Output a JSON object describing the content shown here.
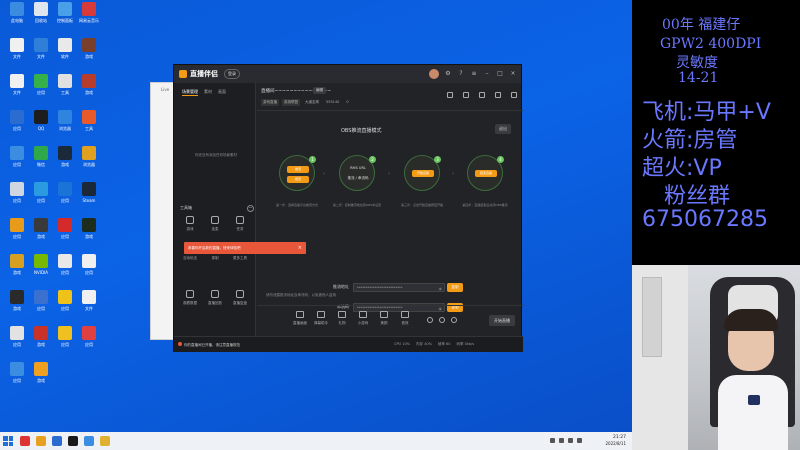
{
  "desktop": {
    "icons": [
      {
        "label": "此电脑",
        "color": "#3b8be0"
      },
      {
        "label": "回收站",
        "color": "#dfe6ee"
      },
      {
        "label": "控制面板",
        "color": "#4aa0e8"
      },
      {
        "label": "网易云音乐",
        "color": "#d63a3a"
      },
      {
        "label": "文件",
        "color": "#f0f0f0"
      },
      {
        "label": "文件",
        "color": "#2f7fd8"
      },
      {
        "label": "软件",
        "color": "#e9e9e9"
      },
      {
        "label": "游戏",
        "color": "#7a3f2a"
      },
      {
        "label": "文件",
        "color": "#f0f0f0"
      },
      {
        "label": "应用",
        "color": "#36b14a"
      },
      {
        "label": "工具",
        "color": "#e0e0e0"
      },
      {
        "label": "游戏",
        "color": "#b83c2c"
      },
      {
        "label": "应用",
        "color": "#2b6cd0"
      },
      {
        "label": "QQ",
        "color": "#1d1d1d"
      },
      {
        "label": "浏览器",
        "color": "#2f84e0"
      },
      {
        "label": "工具",
        "color": "#e85a2a"
      },
      {
        "label": "应用",
        "color": "#3a8de0"
      },
      {
        "label": "微信",
        "color": "#2fa84a"
      },
      {
        "label": "游戏",
        "color": "#1b2a3a"
      },
      {
        "label": "浏览器",
        "color": "#e0a020"
      },
      {
        "label": "应用",
        "color": "#cfd6df"
      },
      {
        "label": "应用",
        "color": "#2a9be0"
      },
      {
        "label": "应用",
        "color": "#1a73d6"
      },
      {
        "label": "Steam",
        "color": "#1b2838"
      },
      {
        "label": "应用",
        "color": "#e89a1a"
      },
      {
        "label": "游戏",
        "color": "#3a3a3a"
      },
      {
        "label": "应用",
        "color": "#d42a2a"
      },
      {
        "label": "游戏",
        "color": "#1d2d1d"
      },
      {
        "label": "游戏",
        "color": "#d8a020"
      },
      {
        "label": "NVIDIA",
        "color": "#76b900"
      },
      {
        "label": "应用",
        "color": "#e8e8e8"
      },
      {
        "label": "应用",
        "color": "#f0f0f0"
      },
      {
        "label": "游戏",
        "color": "#2a2a2a"
      },
      {
        "label": "应用",
        "color": "#3a70d0"
      },
      {
        "label": "应用",
        "color": "#efc21a"
      },
      {
        "label": "文件",
        "color": "#f0f0f0"
      },
      {
        "label": "应用",
        "color": "#e2e2e2"
      },
      {
        "label": "游戏",
        "color": "#c83228"
      },
      {
        "label": "应用",
        "color": "#f0c020"
      },
      {
        "label": "应用",
        "color": "#e04040"
      },
      {
        "label": "应用",
        "color": "#3a8de0"
      },
      {
        "label": "游戏",
        "color": "#f0a020"
      }
    ]
  },
  "bg_window": {
    "title": "Live"
  },
  "app": {
    "name": "直播伴侣",
    "login": "登录",
    "sidebar": {
      "tabs": [
        "场景管理",
        "素材",
        "画面"
      ],
      "empty_text": "你还没有添加任何场景素材",
      "tools_title": "工具箱",
      "tools": [
        {
          "label": "游戏"
        },
        {
          "label": "连麦"
        },
        {
          "label": "任务"
        },
        {
          "label": "互动玩法"
        },
        {
          "label": "录制"
        },
        {
          "label": "更多工具"
        },
        {
          "label": "观看数据"
        },
        {
          "label": "直播回放"
        },
        {
          "label": "直播复盘"
        }
      ]
    },
    "toast": {
      "text": "恭喜你开启新的直播，快来体验吧",
      "close": "×"
    },
    "topbar": {
      "room_title": "直播间~~~~~~~~~~~~~~~",
      "edit": "编辑",
      "meta": [
        "游戏直播",
        "英雄联盟",
        "大道至简",
        "555140"
      ],
      "viewers": "0"
    },
    "main": {
      "obs_title": "OBS推流直播模式",
      "obs_button": "退出",
      "steps": [
        {
          "num": "1",
          "pills": [
            "推流",
            "推流"
          ],
          "desc": "第一步：选择直播平台推流方式"
        },
        {
          "num": "2",
          "text": [
            "RMS URL",
            "推流 / 串流码"
          ],
          "desc": "第二步：复制推流地址到OBS中设置"
        },
        {
          "num": "3",
          "pill": "开始直播",
          "desc": "第三步：点击开始直播按钮开播"
        },
        {
          "num": "4",
          "pill": "结束直播",
          "desc": "第四步：直播结束后关闭OBS推流"
        }
      ],
      "arrows": [
        "›",
        "›",
        "›"
      ],
      "fields": [
        {
          "label": "推流地址",
          "value": "**************************",
          "copy": "复制"
        },
        {
          "label": "串流码",
          "value": "**************************",
          "copy": "复制"
        }
      ],
      "hint": "请勿泄露推流地址及串流码，以免被他人盗用"
    },
    "bottombar": {
      "tools": [
        "直播画面",
        "弹幕助手",
        "礼物",
        "小游戏",
        "美颜",
        "音效"
      ],
      "start_live": "开始直播"
    },
    "statusbar": {
      "notice": "你的直播间已开播，请注意直播规范",
      "stats": [
        "CPU 10%",
        "内存 40%",
        "帧率 60",
        "码率 0kb/s"
      ]
    }
  },
  "taskbar": {
    "apps": [
      {
        "color": "#d33"
      },
      {
        "color": "#e8a020"
      },
      {
        "color": "#2b6cd0"
      },
      {
        "color": "#1a1a1a"
      },
      {
        "color": "#3a8de0"
      },
      {
        "color": "#e0b030"
      }
    ],
    "time": "21:27",
    "date": "2022/8/11"
  },
  "overlay": {
    "line1": "00年 福建仔",
    "line2": "GPW2 400DPI",
    "line3": "灵敏度",
    "line4": "14-21",
    "line5": "飞机:马甲+V",
    "line6": "火箭:房管",
    "line7": "超火:VP",
    "line8": "粉丝群",
    "line9": "675067285"
  }
}
